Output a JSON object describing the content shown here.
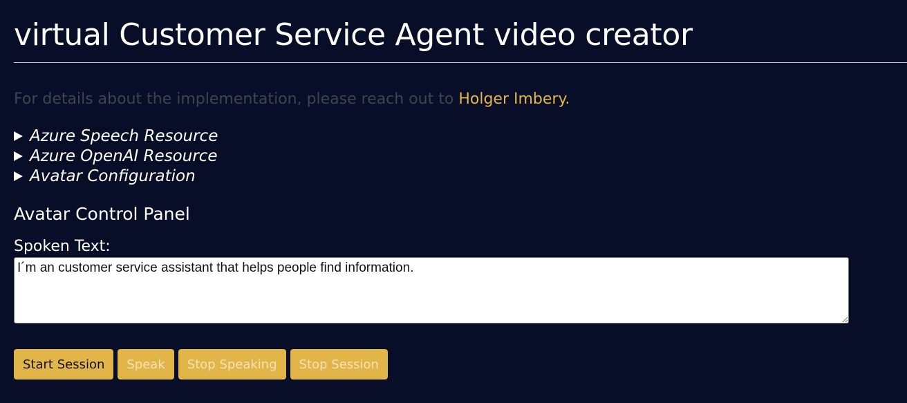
{
  "header": {
    "title": "virtual Customer Service Agent video creator"
  },
  "info": {
    "prefix": "For details about the implementation, please reach out to ",
    "contact_link": "Holger Imbery."
  },
  "sections": [
    {
      "label": "Azure Speech Resource"
    },
    {
      "label": "Azure OpenAI Resource"
    },
    {
      "label": "Avatar Configuration"
    }
  ],
  "control_panel": {
    "title": "Avatar Control Panel",
    "spoken_label": "Spoken Text:",
    "spoken_value": "I´m an customer service assistant that helps people find information."
  },
  "buttons": {
    "start_session": "Start Session",
    "speak": "Speak",
    "stop_speaking": "Stop Speaking",
    "stop_session": "Stop Session"
  },
  "colors": {
    "background": "#080e27",
    "accent": "#e2b548",
    "muted_text": "#3e4455"
  }
}
